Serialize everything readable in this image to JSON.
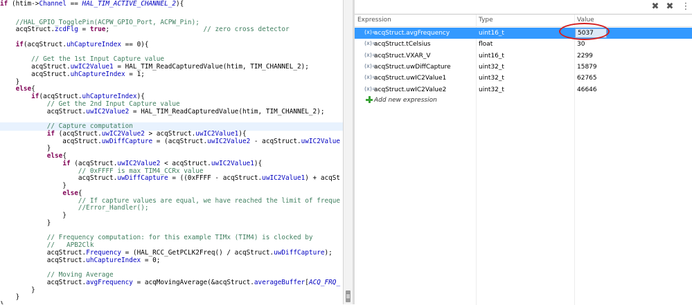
{
  "editor": {
    "lines": [
      [
        {
          "t": "if",
          "s": "k"
        },
        {
          "t": " (htim->"
        },
        {
          "t": "Channel",
          "s": "f"
        },
        {
          "t": " == "
        },
        {
          "t": "HAL_TIM_ACTIVE_CHANNEL_2",
          "s": "mi"
        },
        {
          "t": "){"
        }
      ],
      [],
      [
        {
          "t": "    "
        },
        {
          "t": "//HAL_GPIO_TogglePin(ACPW_GPIO_Port, ACPW_Pin);",
          "s": "c"
        }
      ],
      [
        {
          "t": "    acqStruct."
        },
        {
          "t": "zcdFlg",
          "s": "f"
        },
        {
          "t": " = "
        },
        {
          "t": "true",
          "s": "k"
        },
        {
          "t": ";                        "
        },
        {
          "t": "// zero cross detector",
          "s": "c"
        }
      ],
      [],
      [
        {
          "t": "    "
        },
        {
          "t": "if",
          "s": "k"
        },
        {
          "t": "(acqStruct."
        },
        {
          "t": "uhCaptureIndex",
          "s": "f"
        },
        {
          "t": " == 0){"
        }
      ],
      [],
      [
        {
          "t": "        "
        },
        {
          "t": "// Get the 1st Input Capture value",
          "s": "c"
        }
      ],
      [
        {
          "t": "        acqStruct."
        },
        {
          "t": "uwIC2Value1",
          "s": "f"
        },
        {
          "t": " = HAL_TIM_ReadCapturedValue(htim, TIM_CHANNEL_2);"
        }
      ],
      [
        {
          "t": "        acqStruct."
        },
        {
          "t": "uhCaptureIndex",
          "s": "f"
        },
        {
          "t": " = 1;"
        }
      ],
      [
        {
          "t": "    }"
        }
      ],
      [
        {
          "t": "    "
        },
        {
          "t": "else",
          "s": "k"
        },
        {
          "t": "{"
        }
      ],
      [
        {
          "t": "        "
        },
        {
          "t": "if",
          "s": "k"
        },
        {
          "t": "(acqStruct."
        },
        {
          "t": "uhCaptureIndex",
          "s": "f"
        },
        {
          "t": "){"
        }
      ],
      [
        {
          "t": "            "
        },
        {
          "t": "// Get the 2nd Input Capture value",
          "s": "c"
        }
      ],
      [
        {
          "t": "            acqStruct."
        },
        {
          "t": "uwIC2Value2",
          "s": "f"
        },
        {
          "t": " = HAL_TIM_ReadCapturedValue(htim, TIM_CHANNEL_2);"
        }
      ],
      [],
      [
        {
          "t": "            "
        },
        {
          "t": "// Capture computation",
          "s": "c"
        }
      ],
      [
        {
          "t": "            "
        },
        {
          "t": "if",
          "s": "k"
        },
        {
          "t": " (acqStruct."
        },
        {
          "t": "uwIC2Value2",
          "s": "f"
        },
        {
          "t": " > acqStruct."
        },
        {
          "t": "uwIC2Value1",
          "s": "f"
        },
        {
          "t": "){"
        }
      ],
      [
        {
          "t": "                acqStruct."
        },
        {
          "t": "uwDiffCapture",
          "s": "f"
        },
        {
          "t": " = (acqStruct."
        },
        {
          "t": "uwIC2Value2",
          "s": "f"
        },
        {
          "t": " - acqStruct."
        },
        {
          "t": "uwIC2Value",
          "s": "f"
        }
      ],
      [
        {
          "t": "            }"
        }
      ],
      [
        {
          "t": "            "
        },
        {
          "t": "else",
          "s": "k"
        },
        {
          "t": "{"
        }
      ],
      [
        {
          "t": "                "
        },
        {
          "t": "if",
          "s": "k"
        },
        {
          "t": " (acqStruct."
        },
        {
          "t": "uwIC2Value2",
          "s": "f"
        },
        {
          "t": " < acqStruct."
        },
        {
          "t": "uwIC2Value1",
          "s": "f"
        },
        {
          "t": "){"
        }
      ],
      [
        {
          "t": "                    "
        },
        {
          "t": "// 0xFFFF is max TIM4_CCRx value",
          "s": "c"
        }
      ],
      [
        {
          "t": "                    acqStruct."
        },
        {
          "t": "uwDiffCapture",
          "s": "f"
        },
        {
          "t": " = ((0xFFFF - acqStruct."
        },
        {
          "t": "uwIC2Value1",
          "s": "f"
        },
        {
          "t": ") + acqSt"
        }
      ],
      [
        {
          "t": "                }"
        }
      ],
      [
        {
          "t": "                "
        },
        {
          "t": "else",
          "s": "k"
        },
        {
          "t": "{"
        }
      ],
      [
        {
          "t": "                    "
        },
        {
          "t": "// If capture values are equal, we have reached the limit of freque",
          "s": "c"
        }
      ],
      [
        {
          "t": "                    "
        },
        {
          "t": "//Error_Handler();",
          "s": "c"
        }
      ],
      [
        {
          "t": "                }"
        }
      ],
      [
        {
          "t": "            }"
        }
      ],
      [],
      [
        {
          "t": "            "
        },
        {
          "t": "// Frequency computation: for this example TIMx (TIM4) is clocked by",
          "s": "c"
        }
      ],
      [
        {
          "t": "            "
        },
        {
          "t": "//   APB2Clk",
          "s": "c"
        }
      ],
      [
        {
          "t": "            acqStruct."
        },
        {
          "t": "Frequency",
          "s": "f"
        },
        {
          "t": " = (HAL_RCC_GetPCLK2Freq() / acqStruct."
        },
        {
          "t": "uwDiffCapture",
          "s": "f"
        },
        {
          "t": ");"
        }
      ],
      [
        {
          "t": "            acqStruct."
        },
        {
          "t": "uhCaptureIndex",
          "s": "f"
        },
        {
          "t": " = 0;"
        }
      ],
      [],
      [
        {
          "t": "            "
        },
        {
          "t": "// Moving Average",
          "s": "c"
        }
      ],
      [
        {
          "t": "            acqStruct."
        },
        {
          "t": "avgFrequency",
          "s": "f"
        },
        {
          "t": " = acqMovingAverage(&acqStruct."
        },
        {
          "t": "averageBuffer",
          "s": "f"
        },
        {
          "t": "["
        },
        {
          "t": "ACQ_FRQ_",
          "s": "mi"
        }
      ],
      [
        {
          "t": "        }"
        }
      ],
      [
        {
          "t": "    }"
        }
      ],
      [
        {
          "t": "}"
        }
      ]
    ],
    "highlighted_line": 16
  },
  "expressions": {
    "columns": [
      "Expression",
      "Type",
      "Value"
    ],
    "rows": [
      {
        "expr": "acqStruct.avgFrequency",
        "type": "uint16_t",
        "value": "5037",
        "selected": true
      },
      {
        "expr": "acqStruct.tCelsius",
        "type": "float",
        "value": "30"
      },
      {
        "expr": "acqStruct.VXAR_V",
        "type": "uint16_t",
        "value": "2299"
      },
      {
        "expr": "acqStruct.uwDiffCapture",
        "type": "uint32_t",
        "value": "15879"
      },
      {
        "expr": "acqStruct.uwIC2Value1",
        "type": "uint32_t",
        "value": "62765"
      },
      {
        "expr": "acqStruct.uwIC2Value2",
        "type": "uint32_t",
        "value": "46646"
      }
    ],
    "add_label": "Add new expression",
    "var_icon": "(x)="
  },
  "toolbar": {
    "remove_icon": "✖",
    "remove_all_icon": "✖",
    "menu_icon": "⋮"
  },
  "colors": {
    "selection": "#3399ff",
    "annotation": "#d41f1f"
  }
}
